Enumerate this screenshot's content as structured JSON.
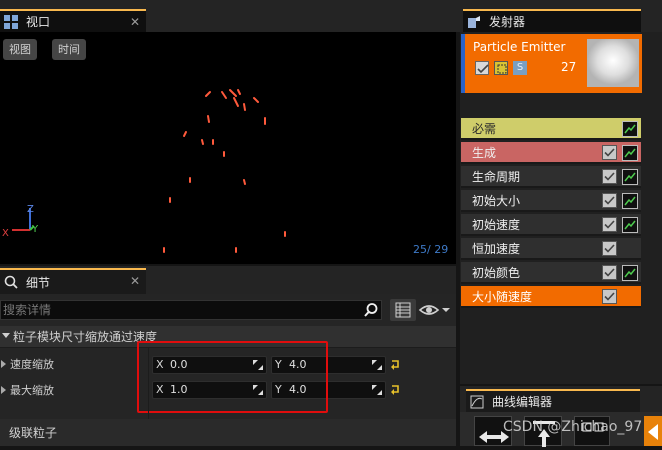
{
  "viewport": {
    "tab_title": "视口",
    "view_button": "视图",
    "time_button": "时间",
    "counter": "25/  29",
    "axes": {
      "x": "X",
      "y": "Y",
      "z": "Z"
    }
  },
  "details": {
    "tab_title": "细节",
    "search_placeholder": "搜索详情",
    "category": "粒子模块尺寸缩放通过速度",
    "rows": [
      {
        "label": "速度缩放",
        "x_axis": "X",
        "x": "0.0",
        "y_axis": "Y",
        "y": "4.0"
      },
      {
        "label": "最大缩放",
        "x_axis": "X",
        "x": "1.0",
        "y_axis": "Y",
        "y": "4.0"
      }
    ],
    "cascade_label": "级联粒子"
  },
  "emitters": {
    "tab_title": "发射器",
    "emitter_name": "Particle Emitter",
    "solo_label": "S",
    "count": "27",
    "modules": [
      {
        "label": "必需",
        "color": "#cfcd6a",
        "text_color": "#2b2b2b",
        "checkbox": false,
        "graph": true
      },
      {
        "label": "生成",
        "color": "#c96563",
        "text_color": "#f0f0f0",
        "checkbox": true,
        "graph": true
      },
      {
        "label": "生命周期",
        "color": "#2f2f2f",
        "text_color": "#f0f0f0",
        "checkbox": true,
        "graph": true
      },
      {
        "label": "初始大小",
        "color": "#2f2f2f",
        "text_color": "#f0f0f0",
        "checkbox": true,
        "graph": true
      },
      {
        "label": "初始速度",
        "color": "#2f2f2f",
        "text_color": "#f0f0f0",
        "checkbox": true,
        "graph": true
      },
      {
        "label": "恒加速度",
        "color": "#2f2f2f",
        "text_color": "#f0f0f0",
        "checkbox": true,
        "graph": false
      },
      {
        "label": "初始颜色",
        "color": "#2f2f2f",
        "text_color": "#f0f0f0",
        "checkbox": true,
        "graph": true
      },
      {
        "label": "大小随速度",
        "color": "#f26b00",
        "text_color": "#ffffff",
        "checkbox": true,
        "graph": false
      }
    ]
  },
  "curve_editor": {
    "tab_title": "曲线编辑器"
  },
  "watermark": "CSDN @Zhichao_97",
  "colors": {
    "accent_orange": "#f26b00",
    "tab_highlight": "#f8b84e",
    "highlight_box": "#e00d0d",
    "particle": "#ff5a3c"
  }
}
